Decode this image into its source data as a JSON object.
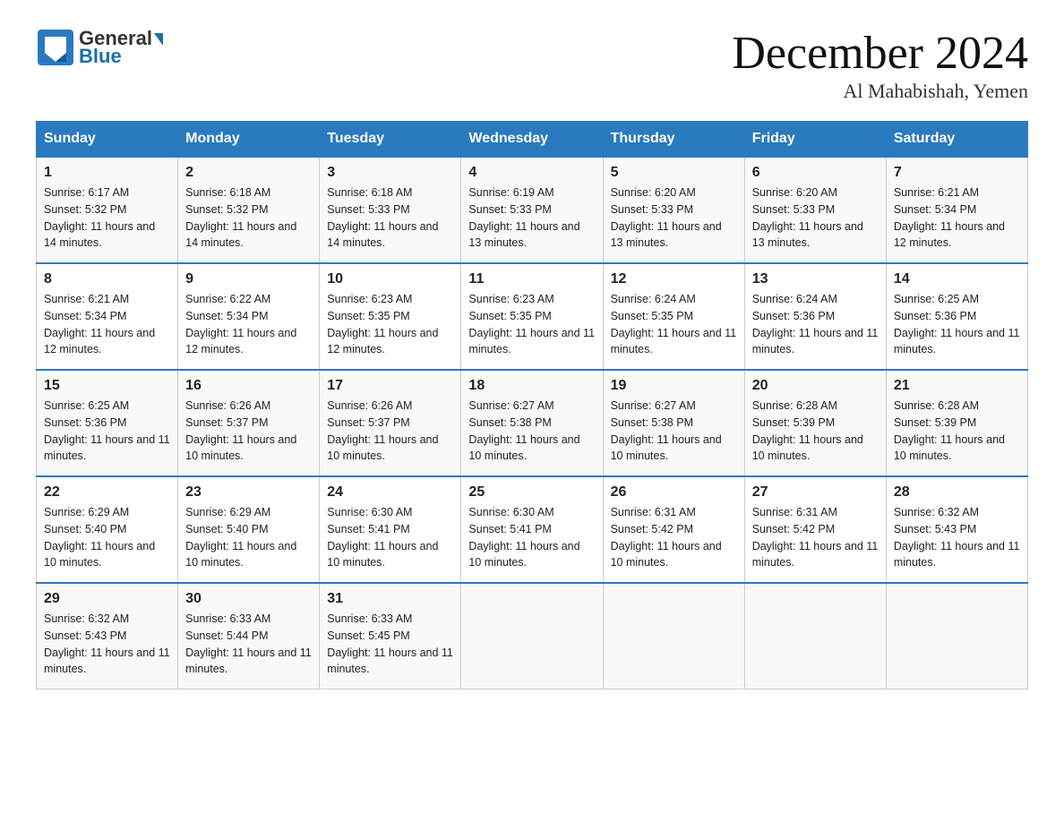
{
  "header": {
    "logo_line1": "General",
    "logo_line2": "Blue",
    "month_title": "December 2024",
    "location": "Al Mahabishah, Yemen"
  },
  "columns": [
    "Sunday",
    "Monday",
    "Tuesday",
    "Wednesday",
    "Thursday",
    "Friday",
    "Saturday"
  ],
  "weeks": [
    [
      {
        "day": "1",
        "sunrise": "6:17 AM",
        "sunset": "5:32 PM",
        "daylight": "11 hours and 14 minutes."
      },
      {
        "day": "2",
        "sunrise": "6:18 AM",
        "sunset": "5:32 PM",
        "daylight": "11 hours and 14 minutes."
      },
      {
        "day": "3",
        "sunrise": "6:18 AM",
        "sunset": "5:33 PM",
        "daylight": "11 hours and 14 minutes."
      },
      {
        "day": "4",
        "sunrise": "6:19 AM",
        "sunset": "5:33 PM",
        "daylight": "11 hours and 13 minutes."
      },
      {
        "day": "5",
        "sunrise": "6:20 AM",
        "sunset": "5:33 PM",
        "daylight": "11 hours and 13 minutes."
      },
      {
        "day": "6",
        "sunrise": "6:20 AM",
        "sunset": "5:33 PM",
        "daylight": "11 hours and 13 minutes."
      },
      {
        "day": "7",
        "sunrise": "6:21 AM",
        "sunset": "5:34 PM",
        "daylight": "11 hours and 12 minutes."
      }
    ],
    [
      {
        "day": "8",
        "sunrise": "6:21 AM",
        "sunset": "5:34 PM",
        "daylight": "11 hours and 12 minutes."
      },
      {
        "day": "9",
        "sunrise": "6:22 AM",
        "sunset": "5:34 PM",
        "daylight": "11 hours and 12 minutes."
      },
      {
        "day": "10",
        "sunrise": "6:23 AM",
        "sunset": "5:35 PM",
        "daylight": "11 hours and 12 minutes."
      },
      {
        "day": "11",
        "sunrise": "6:23 AM",
        "sunset": "5:35 PM",
        "daylight": "11 hours and 11 minutes."
      },
      {
        "day": "12",
        "sunrise": "6:24 AM",
        "sunset": "5:35 PM",
        "daylight": "11 hours and 11 minutes."
      },
      {
        "day": "13",
        "sunrise": "6:24 AM",
        "sunset": "5:36 PM",
        "daylight": "11 hours and 11 minutes."
      },
      {
        "day": "14",
        "sunrise": "6:25 AM",
        "sunset": "5:36 PM",
        "daylight": "11 hours and 11 minutes."
      }
    ],
    [
      {
        "day": "15",
        "sunrise": "6:25 AM",
        "sunset": "5:36 PM",
        "daylight": "11 hours and 11 minutes."
      },
      {
        "day": "16",
        "sunrise": "6:26 AM",
        "sunset": "5:37 PM",
        "daylight": "11 hours and 10 minutes."
      },
      {
        "day": "17",
        "sunrise": "6:26 AM",
        "sunset": "5:37 PM",
        "daylight": "11 hours and 10 minutes."
      },
      {
        "day": "18",
        "sunrise": "6:27 AM",
        "sunset": "5:38 PM",
        "daylight": "11 hours and 10 minutes."
      },
      {
        "day": "19",
        "sunrise": "6:27 AM",
        "sunset": "5:38 PM",
        "daylight": "11 hours and 10 minutes."
      },
      {
        "day": "20",
        "sunrise": "6:28 AM",
        "sunset": "5:39 PM",
        "daylight": "11 hours and 10 minutes."
      },
      {
        "day": "21",
        "sunrise": "6:28 AM",
        "sunset": "5:39 PM",
        "daylight": "11 hours and 10 minutes."
      }
    ],
    [
      {
        "day": "22",
        "sunrise": "6:29 AM",
        "sunset": "5:40 PM",
        "daylight": "11 hours and 10 minutes."
      },
      {
        "day": "23",
        "sunrise": "6:29 AM",
        "sunset": "5:40 PM",
        "daylight": "11 hours and 10 minutes."
      },
      {
        "day": "24",
        "sunrise": "6:30 AM",
        "sunset": "5:41 PM",
        "daylight": "11 hours and 10 minutes."
      },
      {
        "day": "25",
        "sunrise": "6:30 AM",
        "sunset": "5:41 PM",
        "daylight": "11 hours and 10 minutes."
      },
      {
        "day": "26",
        "sunrise": "6:31 AM",
        "sunset": "5:42 PM",
        "daylight": "11 hours and 10 minutes."
      },
      {
        "day": "27",
        "sunrise": "6:31 AM",
        "sunset": "5:42 PM",
        "daylight": "11 hours and 11 minutes."
      },
      {
        "day": "28",
        "sunrise": "6:32 AM",
        "sunset": "5:43 PM",
        "daylight": "11 hours and 11 minutes."
      }
    ],
    [
      {
        "day": "29",
        "sunrise": "6:32 AM",
        "sunset": "5:43 PM",
        "daylight": "11 hours and 11 minutes."
      },
      {
        "day": "30",
        "sunrise": "6:33 AM",
        "sunset": "5:44 PM",
        "daylight": "11 hours and 11 minutes."
      },
      {
        "day": "31",
        "sunrise": "6:33 AM",
        "sunset": "5:45 PM",
        "daylight": "11 hours and 11 minutes."
      },
      null,
      null,
      null,
      null
    ]
  ],
  "labels": {
    "sunrise": "Sunrise:",
    "sunset": "Sunset:",
    "daylight": "Daylight:"
  }
}
